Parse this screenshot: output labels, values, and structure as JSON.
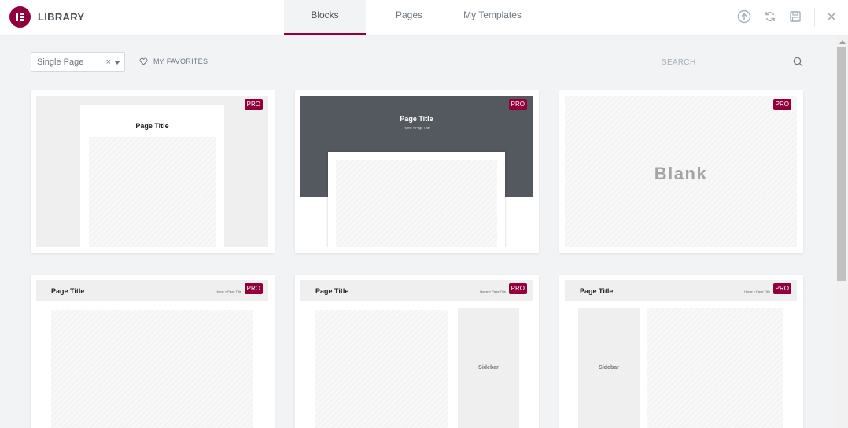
{
  "header": {
    "title": "LIBRARY",
    "tabs": [
      {
        "label": "Blocks",
        "active": true
      },
      {
        "label": "Pages",
        "active": false
      },
      {
        "label": "My Templates",
        "active": false
      }
    ],
    "icons": [
      "upload-icon",
      "sync-icon",
      "save-icon",
      "close-icon"
    ]
  },
  "toolbar": {
    "filter_value": "Single Page",
    "clear_glyph": "×",
    "favorites_label": "MY FAVORITES",
    "search_placeholder": "SEARCH"
  },
  "cards": [
    {
      "badge": "PRO",
      "page_title": "Page Title"
    },
    {
      "badge": "PRO",
      "page_title": "Page Title",
      "breadcrumb": "Home » Page Title"
    },
    {
      "badge": "PRO",
      "label": "Blank"
    },
    {
      "badge": "PRO",
      "page_title": "Page Title",
      "breadcrumb": "Home » Page Title"
    },
    {
      "badge": "PRO",
      "page_title": "Page Title",
      "breadcrumb": "Home » Page Title",
      "sidebar_label": "Sidebar"
    },
    {
      "badge": "PRO",
      "page_title": "Page Title",
      "breadcrumb": "Home » Page Title",
      "sidebar_label": "Sidebar"
    }
  ],
  "colors": {
    "accent": "#92003b",
    "text": "#6d7882",
    "background": "#f1f3f5",
    "dark_header": "#54595f"
  }
}
